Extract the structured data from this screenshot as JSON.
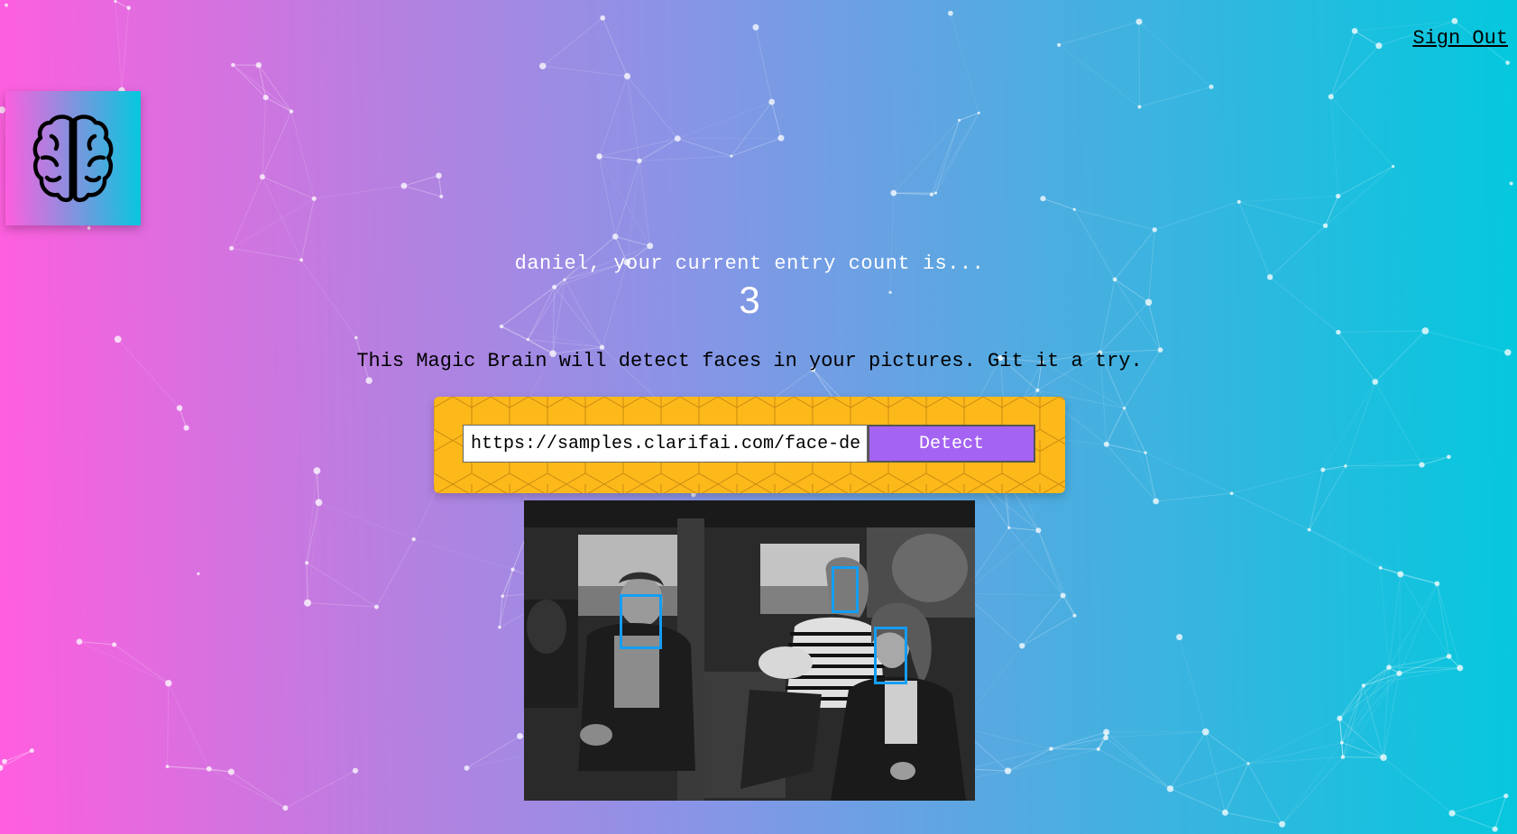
{
  "nav": {
    "sign_out_label": "Sign Out"
  },
  "logo": {
    "icon": "brain-icon"
  },
  "rank": {
    "line": "daniel, your current entry count is...",
    "count": "3"
  },
  "intro_text": "This Magic Brain will detect faces in your pictures. Git it a try.",
  "form": {
    "url_value": "https://samples.clarifai.com/face-det.jpg",
    "detect_label": "Detect"
  },
  "colors": {
    "gradient_left": "#ff5edf",
    "gradient_right": "#04c8de",
    "panel_yellow": "#fdb91a",
    "button_purple": "#a463f2",
    "box_blue": "#149df2"
  },
  "detected_faces_count": 3
}
